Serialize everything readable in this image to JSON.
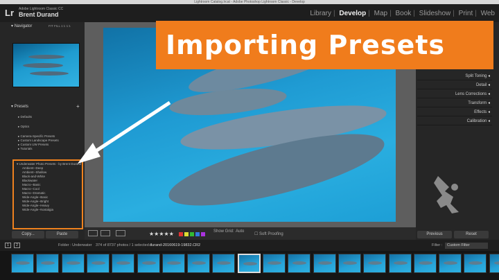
{
  "window": {
    "title": "Lightroom Catalog.lrcat - Adobe Photoshop Lightroom Classic - Develop"
  },
  "identity": {
    "logo": "Lr",
    "app_name": "Adobe Lightroom Classic CC",
    "user": "Brent Durand"
  },
  "modules": {
    "items": [
      "Library",
      "Develop",
      "Map",
      "Book",
      "Slideshow",
      "Print",
      "Web"
    ],
    "active": "Develop"
  },
  "banner": {
    "text": "Importing Presets",
    "color": "#f07c1c"
  },
  "navigator": {
    "title": "Navigator",
    "zoom_options": [
      "FIT",
      "FILL",
      "1:1",
      "1:1"
    ]
  },
  "presets": {
    "title": "Presets",
    "add": "+",
    "groups": [
      "Defaults",
      "Optics",
      "Camera-Specific Presets",
      "Custom Landscape Presets",
      "Custom UW Presets",
      "Tutorials",
      "Underwater Photo Presets - by Brent Durand"
    ],
    "open_group": "Underwater Photo Presets - by Brent Durand",
    "items": [
      "Ambient--Deep",
      "Ambient--Shallow",
      "Black-and-White",
      "Blackwater",
      "Macro--Basic",
      "Macro--Cool",
      "Macro--Dramatic",
      "Wide-Angle--Basic",
      "Wide-Angle--Bright",
      "Wide-Angle--Heavy",
      "Wide-Angle--Nostalgia"
    ]
  },
  "left_buttons": {
    "copy": "Copy...",
    "paste": "Paste"
  },
  "toolbar": {
    "stars": "★★★★★",
    "show_grid_label": "Show Grid:",
    "show_grid_value": "Auto",
    "soft_proofing": "Soft Proofing"
  },
  "color_labels": [
    "#d33",
    "#dd3",
    "#3b3",
    "#37d",
    "#a3d"
  ],
  "right_panel": {
    "sections": [
      "Split Toning",
      "Detail",
      "Lens Corrections",
      "Transform",
      "Effects",
      "Calibration"
    ],
    "previous": "Previous",
    "reset": "Reset"
  },
  "filmstrip_bar": {
    "page_numbers": [
      "1",
      "2"
    ],
    "folder": "Folder : Underwater",
    "count": "374 of 8737 photos / 1 selected /",
    "filename": "durand-20160619-19832.CR2",
    "filter_label": "Filter :",
    "filter_value": "Custom Filter"
  },
  "filmstrip": {
    "thumbnail_count": 20,
    "selected_index": 9
  }
}
